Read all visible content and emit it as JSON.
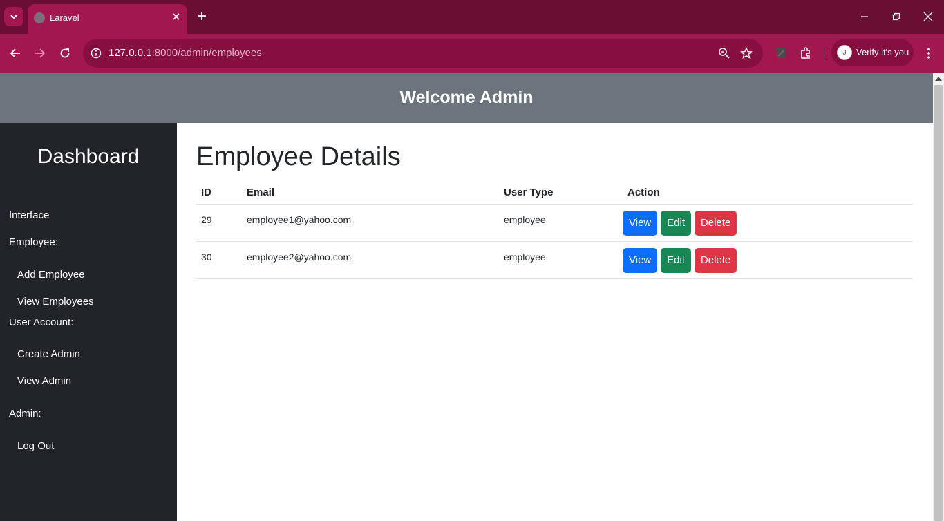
{
  "browser": {
    "tab_title": "Laravel",
    "url_host": "127.0.0.1",
    "url_rest": ":8000/admin/employees",
    "profile_initial": "J",
    "profile_label": "Verify it's you",
    "accent_color": "#a3174f",
    "tabstrip_color": "#6a0e34"
  },
  "icons": [
    "chevron-down-icon",
    "globe-icon",
    "close-icon",
    "plus-icon",
    "minimize-icon",
    "restore-icon",
    "back-arrow-icon",
    "forward-arrow-icon",
    "reload-icon",
    "info-icon",
    "zoom-icon",
    "star-icon",
    "extension-icon",
    "puzzle-icon",
    "kebab-menu-icon"
  ],
  "header": {
    "title": "Welcome Admin",
    "bg_color": "#6c757d"
  },
  "sidebar": {
    "brand": "Dashboard",
    "bg_color": "#212529",
    "sections": {
      "interface": "Interface",
      "employee": "Employee:",
      "add_employee": "Add Employee",
      "view_employees": "View Employees",
      "user_account": "User Account:",
      "create_admin": "Create Admin",
      "view_admin": "View Admin",
      "admin": "Admin:",
      "logout": "Log Out"
    }
  },
  "main": {
    "title": "Employee Details",
    "columns": [
      "ID",
      "Email",
      "User Type",
      "Action"
    ],
    "rows": [
      {
        "id": "29",
        "email": "employee1@yahoo.com",
        "type": "employee"
      },
      {
        "id": "30",
        "email": "employee2@yahoo.com",
        "type": "employee"
      }
    ],
    "actions": {
      "view": "View",
      "edit": "Edit",
      "delete": "Delete"
    },
    "button_colors": {
      "view": "#0d6efd",
      "edit": "#198754",
      "delete": "#dc3545"
    }
  }
}
